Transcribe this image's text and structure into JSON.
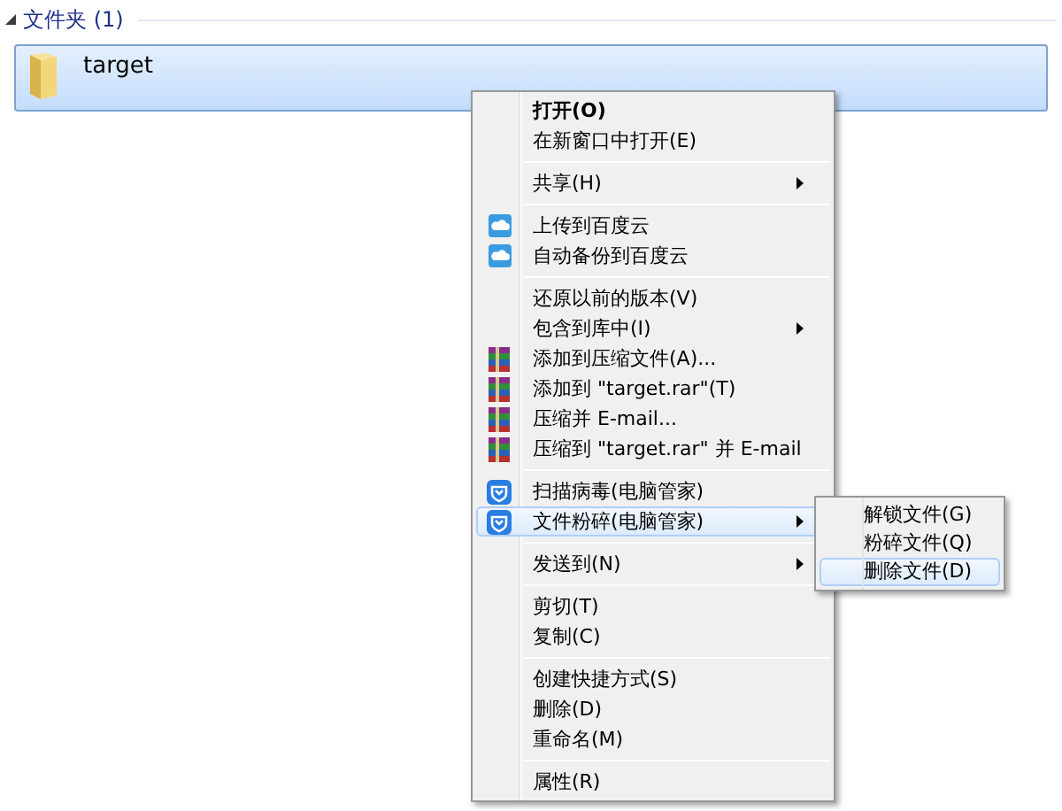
{
  "group": {
    "title": "文件夹 (1)",
    "expanded": true
  },
  "folder": {
    "name": "target",
    "selected": true
  },
  "context_menu": {
    "items": [
      {
        "kind": "plain",
        "label": "打开(O)",
        "bold": true,
        "submenu": false,
        "selected": false
      },
      {
        "kind": "plain",
        "label": "在新窗口中打开(E)",
        "bold": false,
        "submenu": false,
        "selected": false
      },
      {
        "kind": "separator"
      },
      {
        "kind": "plain",
        "label": "共享(H)",
        "bold": false,
        "submenu": true,
        "selected": false
      },
      {
        "kind": "separator"
      },
      {
        "kind": "cloud",
        "label": "上传到百度云",
        "bold": false,
        "submenu": false,
        "selected": false
      },
      {
        "kind": "cloud",
        "label": "自动备份到百度云",
        "bold": false,
        "submenu": false,
        "selected": false
      },
      {
        "kind": "separator"
      },
      {
        "kind": "plain",
        "label": "还原以前的版本(V)",
        "bold": false,
        "submenu": false,
        "selected": false
      },
      {
        "kind": "plain",
        "label": "包含到库中(I)",
        "bold": false,
        "submenu": true,
        "selected": false
      },
      {
        "kind": "archive",
        "label": "添加到压缩文件(A)...",
        "bold": false,
        "submenu": false,
        "selected": false
      },
      {
        "kind": "archive",
        "label": "添加到 \"target.rar\"(T)",
        "bold": false,
        "submenu": false,
        "selected": false
      },
      {
        "kind": "archive",
        "label": "压缩并 E-mail...",
        "bold": false,
        "submenu": false,
        "selected": false
      },
      {
        "kind": "archive",
        "label": "压缩到 \"target.rar\" 并 E-mail",
        "bold": false,
        "submenu": false,
        "selected": false
      },
      {
        "kind": "separator"
      },
      {
        "kind": "shield",
        "label": "扫描病毒(电脑管家)",
        "bold": false,
        "submenu": false,
        "selected": false
      },
      {
        "kind": "shield",
        "label": "文件粉碎(电脑管家)",
        "bold": false,
        "submenu": true,
        "selected": true
      },
      {
        "kind": "separator"
      },
      {
        "kind": "plain",
        "label": "发送到(N)",
        "bold": false,
        "submenu": true,
        "selected": false
      },
      {
        "kind": "separator"
      },
      {
        "kind": "plain",
        "label": "剪切(T)",
        "bold": false,
        "submenu": false,
        "selected": false
      },
      {
        "kind": "plain",
        "label": "复制(C)",
        "bold": false,
        "submenu": false,
        "selected": false
      },
      {
        "kind": "separator"
      },
      {
        "kind": "plain",
        "label": "创建快捷方式(S)",
        "bold": false,
        "submenu": false,
        "selected": false
      },
      {
        "kind": "plain",
        "label": "删除(D)",
        "bold": false,
        "submenu": false,
        "selected": false
      },
      {
        "kind": "plain",
        "label": "重命名(M)",
        "bold": false,
        "submenu": false,
        "selected": false
      },
      {
        "kind": "separator"
      },
      {
        "kind": "plain",
        "label": "属性(R)",
        "bold": false,
        "submenu": false,
        "selected": false
      }
    ]
  },
  "submenu": {
    "items": [
      {
        "label": "解锁文件(G)",
        "selected": false
      },
      {
        "label": "粉碎文件(Q)",
        "selected": false
      },
      {
        "label": "删除文件(D)",
        "selected": true
      }
    ]
  }
}
